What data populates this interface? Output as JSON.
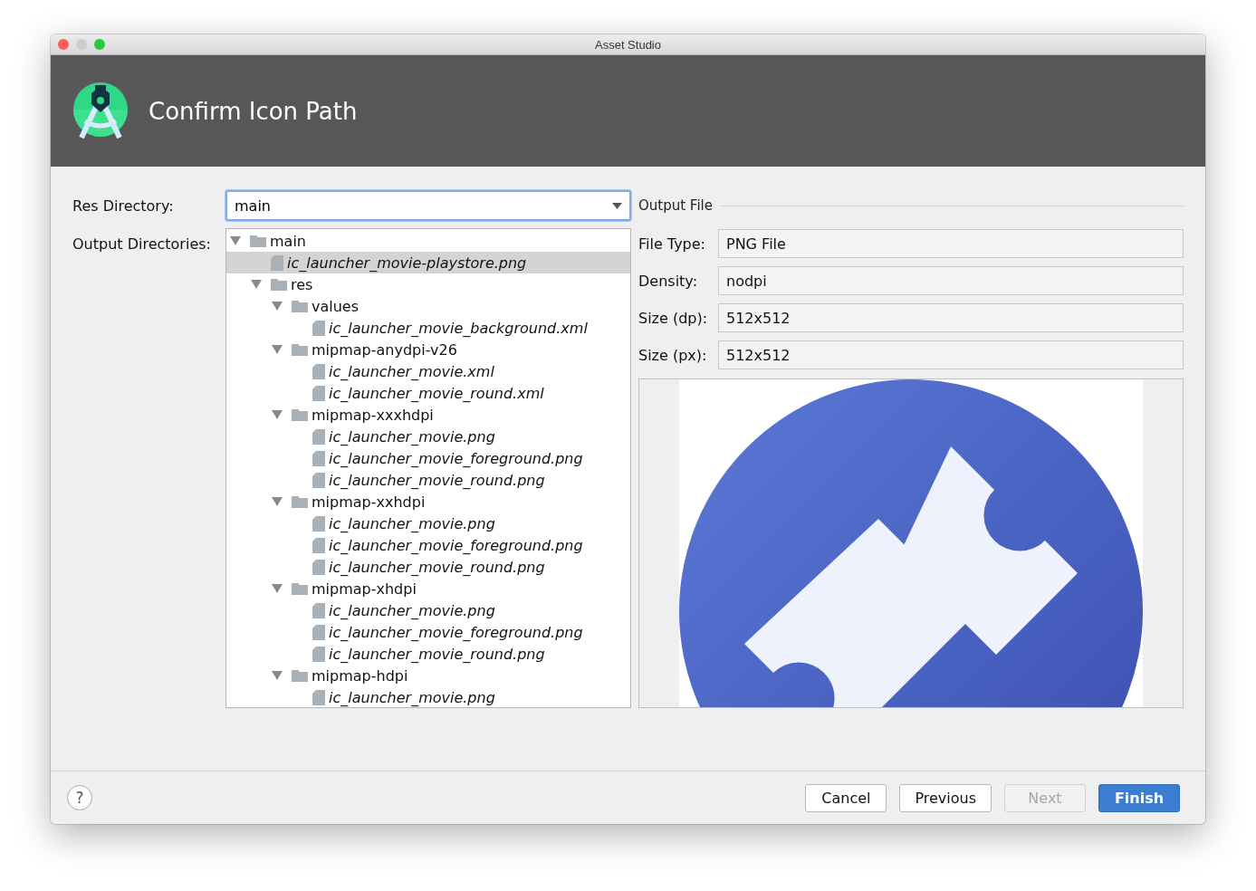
{
  "window": {
    "title": "Asset Studio"
  },
  "header": {
    "title": "Confirm Icon Path"
  },
  "res_directory": {
    "label": "Res Directory:",
    "value": "main"
  },
  "output_directories": {
    "label": "Output Directories:",
    "tree": [
      {
        "kind": "folder",
        "name": "main",
        "expanded": true,
        "selected": false,
        "children": [
          {
            "kind": "file",
            "name": "ic_launcher_movie-playstore.png",
            "selected": true
          },
          {
            "kind": "folder",
            "name": "res",
            "expanded": true,
            "selected": false,
            "children": [
              {
                "kind": "folder",
                "name": "values",
                "expanded": true,
                "selected": false,
                "children": [
                  {
                    "kind": "file",
                    "name": "ic_launcher_movie_background.xml",
                    "selected": false
                  }
                ]
              },
              {
                "kind": "folder",
                "name": "mipmap-anydpi-v26",
                "expanded": true,
                "selected": false,
                "children": [
                  {
                    "kind": "file",
                    "name": "ic_launcher_movie.xml",
                    "selected": false
                  },
                  {
                    "kind": "file",
                    "name": "ic_launcher_movie_round.xml",
                    "selected": false
                  }
                ]
              },
              {
                "kind": "folder",
                "name": "mipmap-xxxhdpi",
                "expanded": true,
                "selected": false,
                "children": [
                  {
                    "kind": "file",
                    "name": "ic_launcher_movie.png",
                    "selected": false
                  },
                  {
                    "kind": "file",
                    "name": "ic_launcher_movie_foreground.png",
                    "selected": false
                  },
                  {
                    "kind": "file",
                    "name": "ic_launcher_movie_round.png",
                    "selected": false
                  }
                ]
              },
              {
                "kind": "folder",
                "name": "mipmap-xxhdpi",
                "expanded": true,
                "selected": false,
                "children": [
                  {
                    "kind": "file",
                    "name": "ic_launcher_movie.png",
                    "selected": false
                  },
                  {
                    "kind": "file",
                    "name": "ic_launcher_movie_foreground.png",
                    "selected": false
                  },
                  {
                    "kind": "file",
                    "name": "ic_launcher_movie_round.png",
                    "selected": false
                  }
                ]
              },
              {
                "kind": "folder",
                "name": "mipmap-xhdpi",
                "expanded": true,
                "selected": false,
                "children": [
                  {
                    "kind": "file",
                    "name": "ic_launcher_movie.png",
                    "selected": false
                  },
                  {
                    "kind": "file",
                    "name": "ic_launcher_movie_foreground.png",
                    "selected": false
                  },
                  {
                    "kind": "file",
                    "name": "ic_launcher_movie_round.png",
                    "selected": false
                  }
                ]
              },
              {
                "kind": "folder",
                "name": "mipmap-hdpi",
                "expanded": true,
                "selected": false,
                "children": [
                  {
                    "kind": "file",
                    "name": "ic_launcher_movie.png",
                    "selected": false
                  }
                ]
              }
            ]
          }
        ]
      }
    ]
  },
  "output_file": {
    "title": "Output File",
    "fields": [
      {
        "label": "File Type:",
        "value": "PNG File"
      },
      {
        "label": "Density:",
        "value": "nodpi"
      },
      {
        "label": "Size (dp):",
        "value": "512x512"
      },
      {
        "label": "Size (px):",
        "value": "512x512"
      }
    ]
  },
  "buttons": [
    {
      "label": "Cancel",
      "disabled": false,
      "default": false
    },
    {
      "label": "Previous",
      "disabled": false,
      "default": false
    },
    {
      "label": "Next",
      "disabled": true,
      "default": false
    },
    {
      "label": "Finish",
      "disabled": false,
      "default": true
    }
  ],
  "help": {
    "label": "?"
  }
}
